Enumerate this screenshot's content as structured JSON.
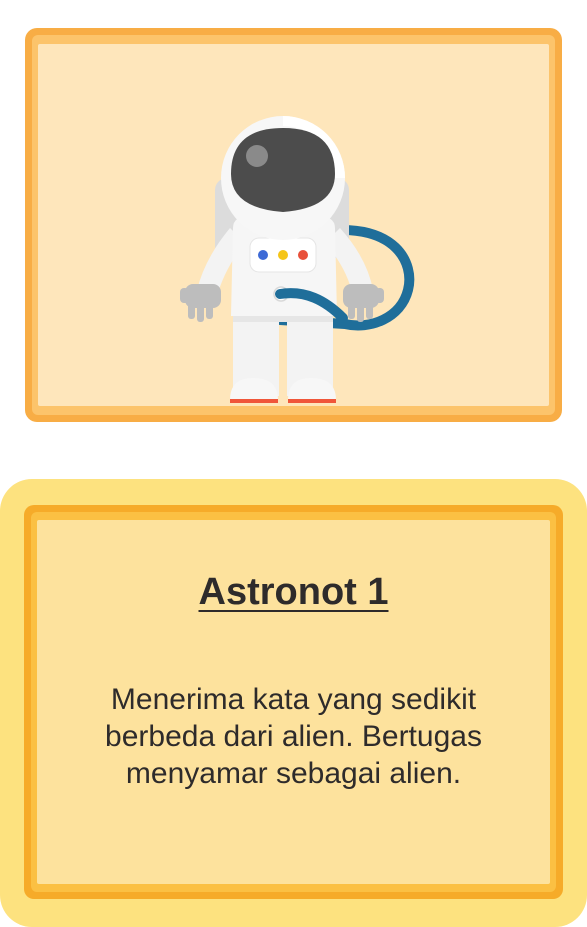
{
  "card": {
    "image": {
      "icon": "astronaut-icon",
      "colors": {
        "frame": "#f8ad45",
        "background": "#fee6bb",
        "suit": "#f3f3f3",
        "visor": "#4c4c4c",
        "hose": "#1f6e9a",
        "boot_sole": "#f0563a"
      },
      "panel_lights": [
        "#3d6ad6",
        "#f5c518",
        "#e8503a"
      ]
    },
    "title": "Astronot 1",
    "description": "Menerima kata yang sedikit berbeda dari alien. Bertugas menyamar sebagai alien.",
    "colors": {
      "outer": "#fde27f",
      "frame": "#f6ab29",
      "background": "#fde29d",
      "text": "#2e2b2b"
    }
  }
}
